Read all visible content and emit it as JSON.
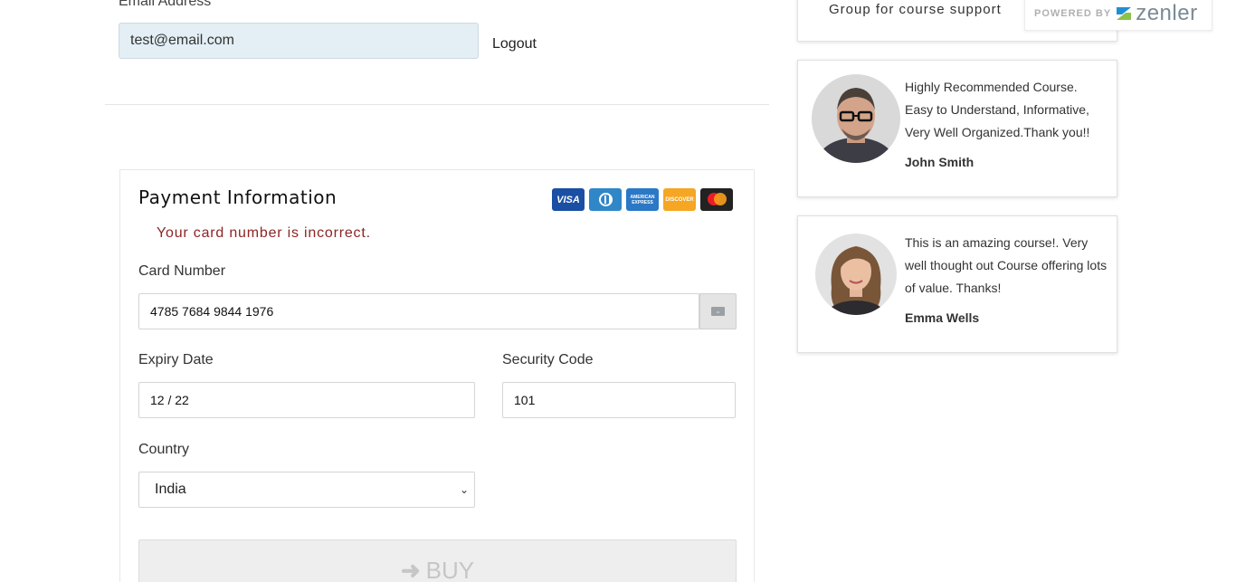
{
  "account": {
    "email_label": "Email Address",
    "email_value": "test@email.com",
    "logout_label": "Logout"
  },
  "payment": {
    "title": "Payment Information",
    "card_brands": [
      "VISA",
      "Diners Club",
      "AMERICAN EXPRESS",
      "DISCOVER",
      "Mastercard"
    ],
    "error": "Your card number is incorrect.",
    "card_number_label": "Card Number",
    "card_number_value": "4785 7684 9844 1976",
    "expiry_label": "Expiry Date",
    "expiry_value": "12 / 22",
    "security_label": "Security Code",
    "security_value": "101",
    "country_label": "Country",
    "country_value": "India",
    "buy_label": "BUY"
  },
  "sidebar": {
    "support_text": "Group for course support",
    "powered_by": "POWERED BY",
    "brand": "zenler",
    "reviews": [
      {
        "text": "Highly Recommended Course. Easy to Understand, Informative, Very Well Organized.Thank you!!",
        "author": "John Smith"
      },
      {
        "text": "This is an amazing course!. Very well thought out Course offering lots of value. Thanks!",
        "author": "Emma Wells"
      }
    ]
  },
  "colors": {
    "error": "#8f2424",
    "email_field_bg": "#e3eef5",
    "buy_disabled_bg": "#eeeeee"
  }
}
